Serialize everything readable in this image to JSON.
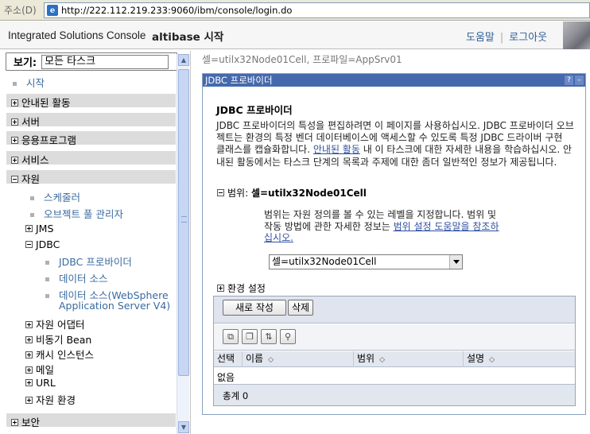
{
  "browser": {
    "address_label": "주소(D)",
    "url": "http://222.112.219.233:9060/ibm/console/login.do"
  },
  "header": {
    "brand": "Integrated Solutions Console",
    "welcome": "altibase 시작",
    "help_link": "도움말",
    "logout_link": "로그아웃"
  },
  "nav": {
    "view_label": "보기:",
    "view_value": "모든 타스크",
    "start": "시작",
    "categories": [
      "안내된 활동",
      "서버",
      "응용프로그램",
      "서비스",
      "자원"
    ],
    "resource_children": {
      "scheduler": "스케줄러",
      "object_pool": "오브젝트 풀 관리자",
      "jms": "JMS",
      "jdbc": "JDBC",
      "jdbc_provider": "JDBC 프로바이더",
      "data_source": "데이터 소스",
      "data_source_v4_line1": "데이터 소스(WebSphere",
      "data_source_v4_line2": "Application Server V4)",
      "resource_adapter": "자원 어댑터",
      "async_bean": "비동기 Bean",
      "cache_instance": "캐시 인스턴스",
      "mail": "메일",
      "url": "URL",
      "resource_env": "자원 환경"
    },
    "security": "보안"
  },
  "main": {
    "breadcrumb": "셀=utilx32Node01Cell, 프로파일=AppSrv01",
    "portlet_title": "JDBC 프로바이더",
    "help_btn": "?",
    "minimize_btn": "–",
    "heading": "JDBC 프로바이더",
    "desc_part1": "JDBC 프로바이더의 특성을 편집하려면 이 페이지를 사용하십시오. JDBC 프로바이더 오브젝트는 환경의 특정 벤더 데이터베이스에 액세스할 수 있도록 특정 JDBC 드라이버 구현 클래스를 캡슐화합니다. ",
    "desc_link": "안내된 활동",
    "desc_part2": " 내 이 타스크에 대한 자세한 내용을 학습하십시오. 안내된 활동에서는 타스크 단계의 목록과 주제에 대한 좀더 일반적인 정보가 제공됩니다.",
    "scope_label": "범위: ",
    "scope_value": "셀=utilx32Node01Cell",
    "scope_desc_part1": "범위는 자원 정의를 볼 수 있는 레벨을 지정합니다. 범위 및 작동 방법에 관한 자세한 정보는 ",
    "scope_desc_link": "범위 설정 도움말을 참조하십시오.",
    "scope_select_value": "셀=utilx32Node01Cell",
    "preferences": "환경 설정"
  },
  "table": {
    "new_button": "새로 작성",
    "delete_button": "삭제",
    "columns": [
      "선택",
      "이름",
      "범위",
      "설명"
    ],
    "empty_text": "없음",
    "total_label": "총계 0"
  }
}
